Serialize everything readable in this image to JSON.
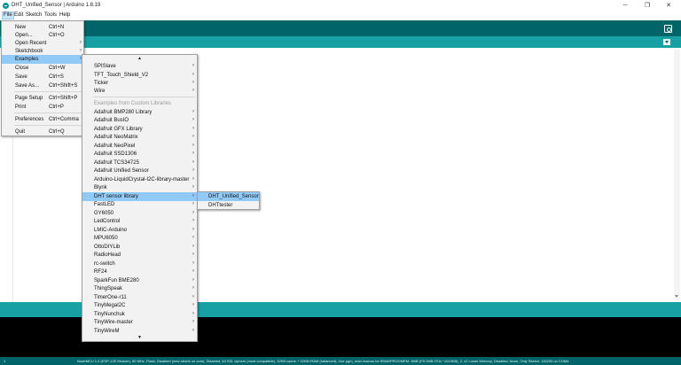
{
  "window": {
    "title": "DHT_Unified_Sensor | Arduino 1.8.19",
    "minimize_glyph": "─",
    "maximize_glyph": "❐",
    "close_glyph": "✕"
  },
  "menubar": {
    "file": "File",
    "edit": "Edit",
    "sketch": "Sketch",
    "tools": "Tools",
    "help": "Help"
  },
  "file_menu": {
    "items": [
      {
        "label": "New",
        "shortcut": "Ctrl+N"
      },
      {
        "label": "Open...",
        "shortcut": "Ctrl+O"
      },
      {
        "label": "Open Recent",
        "shortcut": ""
      },
      {
        "label": "Sketchbook",
        "shortcut": ""
      },
      {
        "label": "Examples",
        "shortcut": ""
      },
      {
        "label": "Close",
        "shortcut": "Ctrl+W"
      },
      {
        "label": "Save",
        "shortcut": "Ctrl+S"
      },
      {
        "label": "Save As...",
        "shortcut": "Ctrl+Shift+S"
      },
      {
        "label": "Page Setup",
        "shortcut": "Ctrl+Shift+P"
      },
      {
        "label": "Print",
        "shortcut": "Ctrl+P"
      },
      {
        "label": "Preferences",
        "shortcut": "Ctrl+Comma"
      },
      {
        "label": "Quit",
        "shortcut": "Ctrl+Q"
      }
    ],
    "submenu_arrow": "›"
  },
  "examples_menu": {
    "scroll_up": "▲",
    "scroll_down": "▼",
    "section_header": "Examples from Custom Libraries",
    "builtin_items": [
      "SPISlave",
      "TFT_Touch_Shield_V2",
      "Ticker",
      "Wire"
    ],
    "library_items": [
      "Adafruit BMP280 Library",
      "Adafruit BusIO",
      "Adafruit GFX Library",
      "Adafruit NeoMatrix",
      "Adafruit NeoPixel",
      "Adafruit SSD1306",
      "Adafruit TCS34725",
      "Adafruit Unified Sensor",
      "Arduino-LiquidCrystal-I2C-library-master",
      "Blynk",
      "DHT sensor library",
      "FastLED",
      "GY6050",
      "LedControl",
      "LMIC-Arduino",
      "MPU6050",
      "OttoDIYLib",
      "RadioHead",
      "rc-switch",
      "RF24",
      "SparkFun BME280",
      "ThingSpeak",
      "TimerOne-r11",
      "TinyMegaI2C",
      "TinyNunchuk",
      "TinyWire-master",
      "TinyWireM"
    ],
    "selected": "DHT sensor library"
  },
  "dht_submenu": {
    "items": [
      "DHT_Unified_Sensor",
      "DHTtester"
    ],
    "selected": "DHT_Unified_Sensor"
  },
  "status_bar": {
    "line_number": "1",
    "board_info": "NodeMCU 1.0 (ESP-12E Module), 80 MHz, Flash, Disabled (new aborts on oom), Disabled, All SSL ciphers (most compatible), 32KB cache + 32KB IRAM (balanced), Use pgm_read macros for IRAM/PROGMEM, 4MB (FS:2MB OTA:~1019KB), 2, v2 Lower Memory, Disabled, None, Only Sketch, 115200 on COM4"
  },
  "colors": {
    "toolbar": "#006468",
    "tabbar": "#17a1a5",
    "console": "#000000",
    "menu_highlight": "#91c9f7"
  }
}
